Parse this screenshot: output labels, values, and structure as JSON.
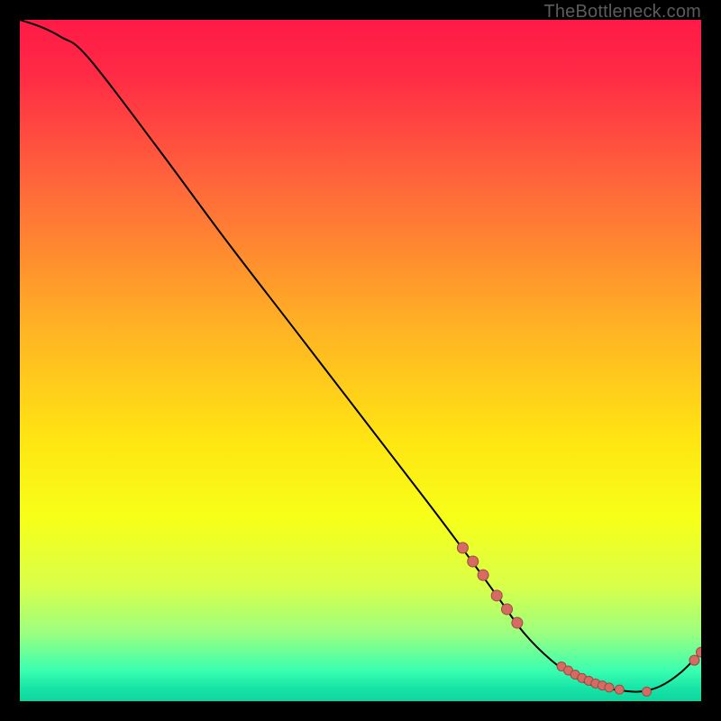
{
  "watermark": {
    "text": "TheBottleneck.com"
  },
  "colors": {
    "gradient_stops": [
      {
        "pos": 0.0,
        "color": "#ff1a47"
      },
      {
        "pos": 0.08,
        "color": "#ff2a45"
      },
      {
        "pos": 0.25,
        "color": "#ff6a3a"
      },
      {
        "pos": 0.45,
        "color": "#ffb224"
      },
      {
        "pos": 0.62,
        "color": "#ffe612"
      },
      {
        "pos": 0.73,
        "color": "#f7ff18"
      },
      {
        "pos": 0.83,
        "color": "#d9ff49"
      },
      {
        "pos": 0.9,
        "color": "#9cff80"
      },
      {
        "pos": 0.955,
        "color": "#3affb0"
      },
      {
        "pos": 0.98,
        "color": "#17e5a8"
      },
      {
        "pos": 1.0,
        "color": "#0fd49c"
      }
    ],
    "curve": "#000000",
    "dot_fill": "#d66b63",
    "dot_stroke": "#9a4b44"
  },
  "chart_data": {
    "type": "line",
    "title": "",
    "xlabel": "",
    "ylabel": "",
    "xlim": [
      0,
      100
    ],
    "ylim": [
      0,
      100
    ],
    "series": [
      {
        "name": "bottleneck-curve",
        "x": [
          0,
          3,
          6,
          10,
          20,
          30,
          40,
          50,
          60,
          66,
          70,
          74,
          78,
          82,
          85,
          88,
          91,
          94,
          97,
          100
        ],
        "y": [
          100,
          99,
          97.5,
          94.5,
          81.5,
          68,
          55,
          42,
          29,
          21,
          15.5,
          10,
          6,
          3.2,
          2.1,
          1.6,
          1.4,
          2.2,
          4.2,
          7.2
        ]
      }
    ],
    "dots": {
      "name": "highlighted-points",
      "x": [
        65,
        66.5,
        68,
        70,
        71.5,
        73,
        79.5,
        80.5,
        81.5,
        82.5,
        83.5,
        84.5,
        85.5,
        86.5,
        88,
        92,
        99,
        100
      ],
      "y": [
        22.5,
        20.5,
        18.5,
        15.5,
        13.5,
        11.5,
        5.1,
        4.5,
        3.9,
        3.4,
        3.0,
        2.6,
        2.3,
        2.0,
        1.7,
        1.4,
        6.0,
        7.2
      ],
      "r": [
        6,
        6,
        6,
        6,
        6,
        6,
        5,
        5,
        5,
        5,
        5,
        5,
        5,
        5,
        5,
        5,
        5.5,
        5.5
      ]
    }
  }
}
